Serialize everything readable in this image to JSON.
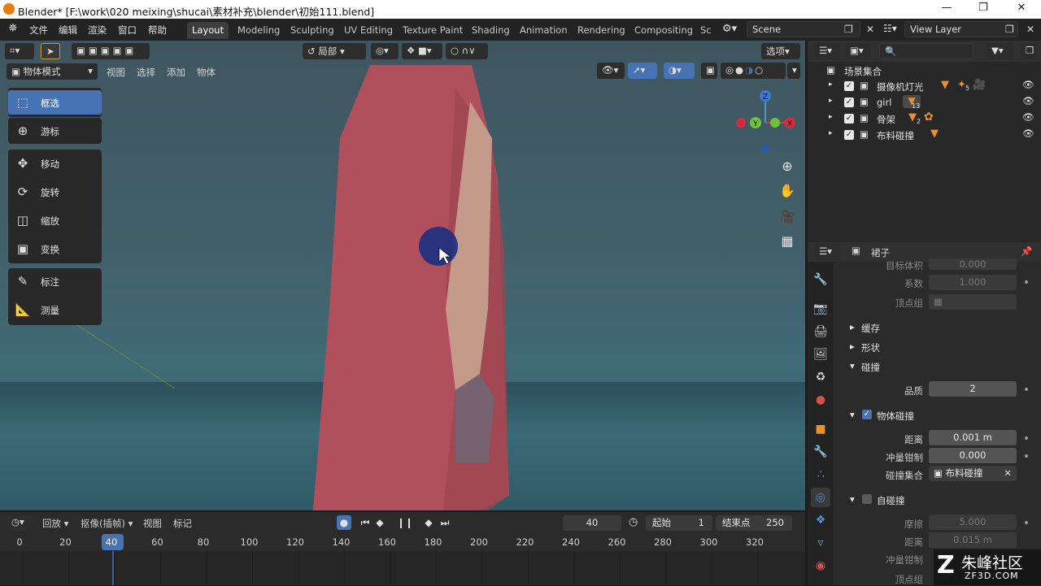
{
  "window": {
    "title": "Blender* [F:\\work\\020 meixing\\shucai\\素材补充\\blender\\初始111.blend]"
  },
  "menu": {
    "items": [
      "文件",
      "编辑",
      "渲染",
      "窗口",
      "帮助"
    ]
  },
  "workspaces": {
    "tabs": [
      "Layout",
      "Modeling",
      "Sculpting",
      "UV Editing",
      "Texture Paint",
      "Shading",
      "Animation",
      "Rendering",
      "Compositing",
      "Sc"
    ],
    "active": "Layout"
  },
  "scene": {
    "name": "Scene"
  },
  "view_layer": {
    "name": "View Layer"
  },
  "viewport_header": {
    "orientation": "局部",
    "options": "选项",
    "mode": "物体模式",
    "menus": [
      "视图",
      "选择",
      "添加",
      "物体"
    ]
  },
  "toolbar": {
    "tools": [
      "框选",
      "游标",
      "移动",
      "旋转",
      "缩放",
      "变换",
      "标注",
      "测量"
    ],
    "active": "框选"
  },
  "gizmo": {
    "axis_z": "Z",
    "axis_y": "Y",
    "axis_x": "X"
  },
  "outliner": {
    "root": "场景集合",
    "items": [
      {
        "label": "摄像机灯光",
        "count": "5"
      },
      {
        "label": "girl",
        "count": "13"
      },
      {
        "label": "骨架",
        "count": "2"
      },
      {
        "label": "布料碰撞",
        "count": ""
      }
    ]
  },
  "properties": {
    "object_name": "裙子",
    "fields": {
      "mass_label": "目标体积",
      "mass_value": "0.000",
      "factor_label": "系数",
      "factor_value": "1.000",
      "vgroup_label": "顶点组",
      "cache": "缓存",
      "shape": "形状",
      "collision": "碰撞",
      "quality_label": "品质",
      "quality_value": "2",
      "object_collision": "物体碰撞",
      "distance_label": "距离",
      "distance_value": "0.001 m",
      "impulse_label": "冲量钳制",
      "impulse_value": "0.000",
      "coll_label": "碰撞集合",
      "coll_value": "布料碰撞",
      "self_collision": "自碰撞",
      "friction_label": "摩擦",
      "friction_value": "5.000",
      "self_dist_label": "距离",
      "self_dist_value": "0.015 m",
      "self_impulse_label": "冲量钳制",
      "self_vgroup_label": "顶点组"
    }
  },
  "timeline": {
    "playback": "回放",
    "keying": "抠像(插帧)",
    "view": "视图",
    "marker": "标记",
    "current_frame": "40",
    "start_label": "起始",
    "start": "1",
    "end_label": "结束点",
    "end": "250",
    "ticks": [
      "0",
      "20",
      "40",
      "60",
      "80",
      "100",
      "120",
      "140",
      "160",
      "180",
      "200",
      "220",
      "240",
      "260",
      "280",
      "300",
      "320"
    ]
  },
  "watermark": {
    "brand": "朱峰社区",
    "site": "ZF3D.COM"
  },
  "colors": {
    "accent": "#4772b3",
    "skirt": "#b0505c",
    "viewport_bg": "#42606b"
  }
}
